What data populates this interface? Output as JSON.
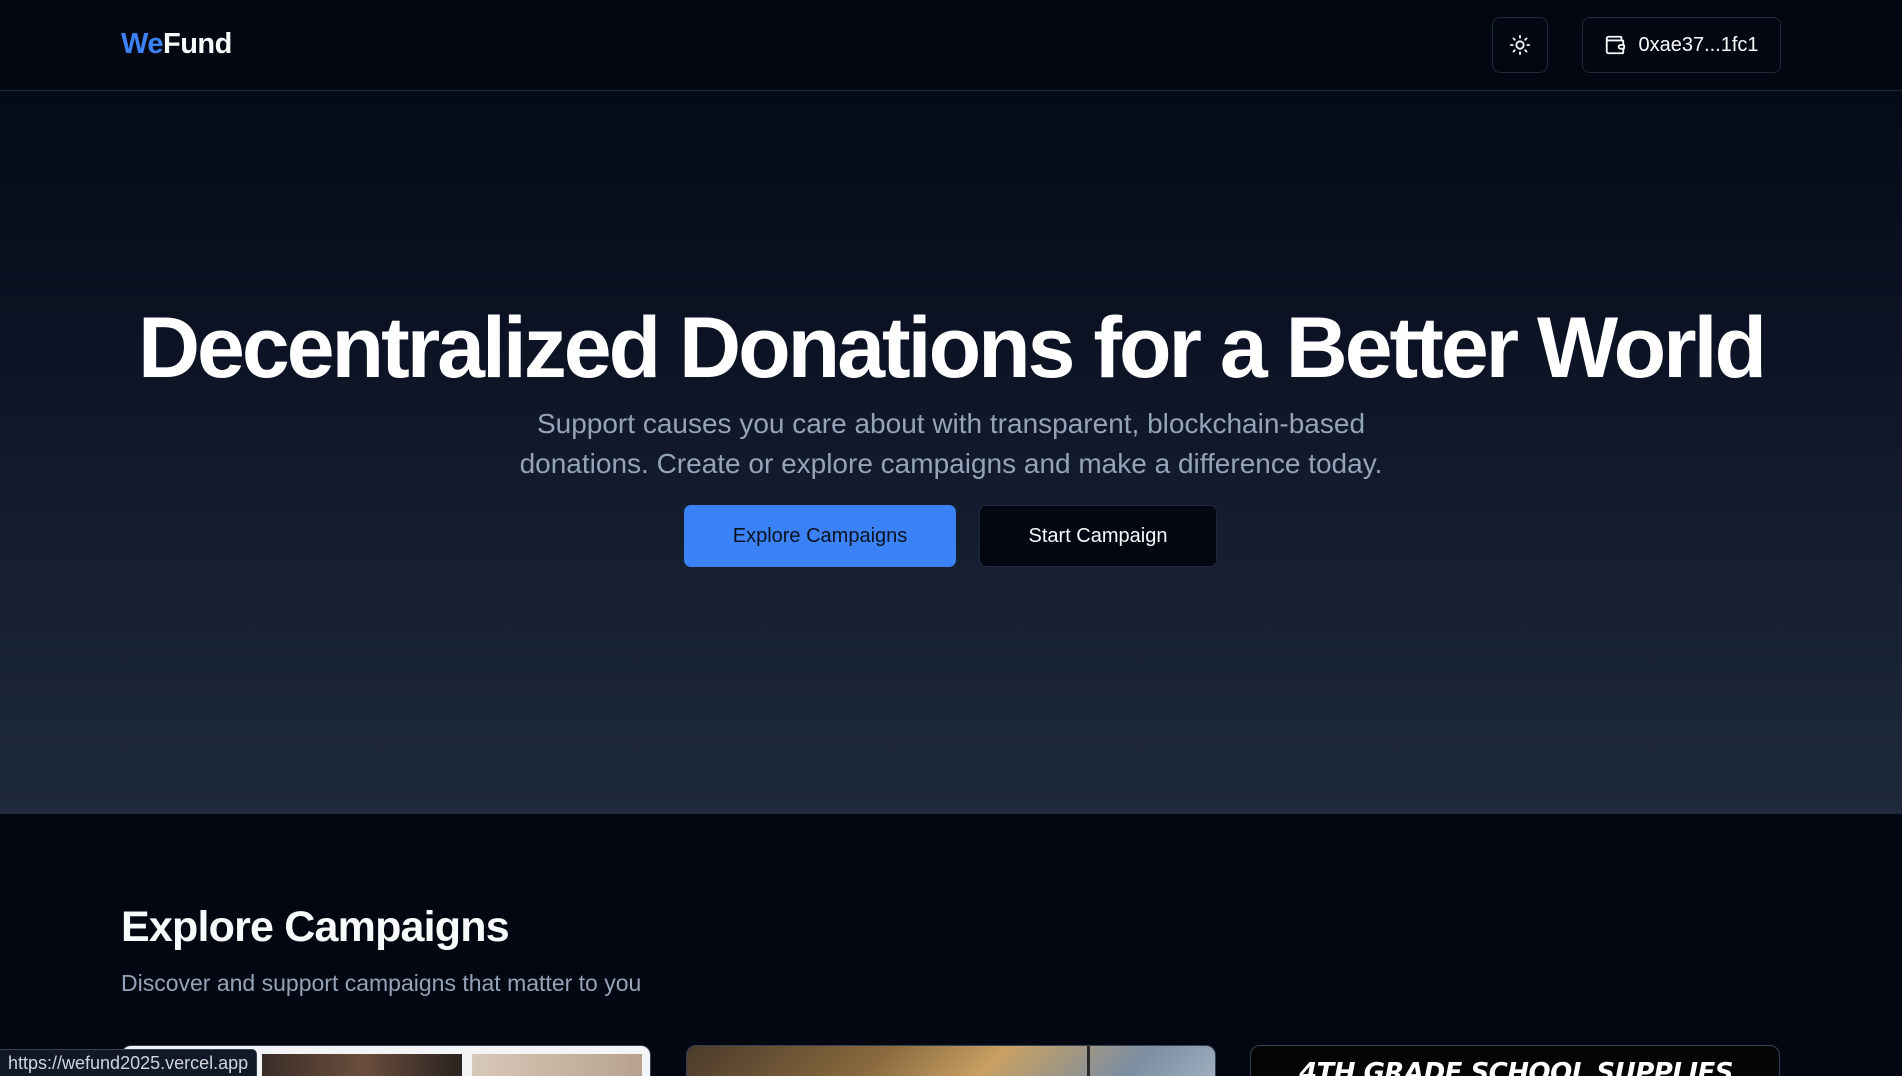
{
  "header": {
    "logo_accent": "We",
    "logo_rest": "Fund",
    "theme_icon": "sun-icon",
    "wallet_icon": "wallet-icon",
    "wallet_address": "0xae37...1fc1"
  },
  "hero": {
    "title": "Decentralized Donations for a Better World",
    "subtitle_line1": "Support causes you care about with transparent, blockchain-based",
    "subtitle_line2": "donations. Create or explore campaigns and make a difference today.",
    "primary_button": "Explore Campaigns",
    "secondary_button": "Start Campaign"
  },
  "explore": {
    "title": "Explore Campaigns",
    "subtitle": "Discover and support campaigns that matter to you",
    "cards": [
      {
        "image": "campaign-photo"
      },
      {
        "image": "campaign-photo"
      },
      {
        "image": "campaign-poster",
        "poster_text": "4TH GRADE SCHOOL SUPPLIES"
      }
    ]
  },
  "status_bar": {
    "url": "https://wefund2025.vercel.app"
  },
  "colors": {
    "accent": "#3b82f6",
    "background": "#030712",
    "muted_text": "#94a3b8"
  }
}
